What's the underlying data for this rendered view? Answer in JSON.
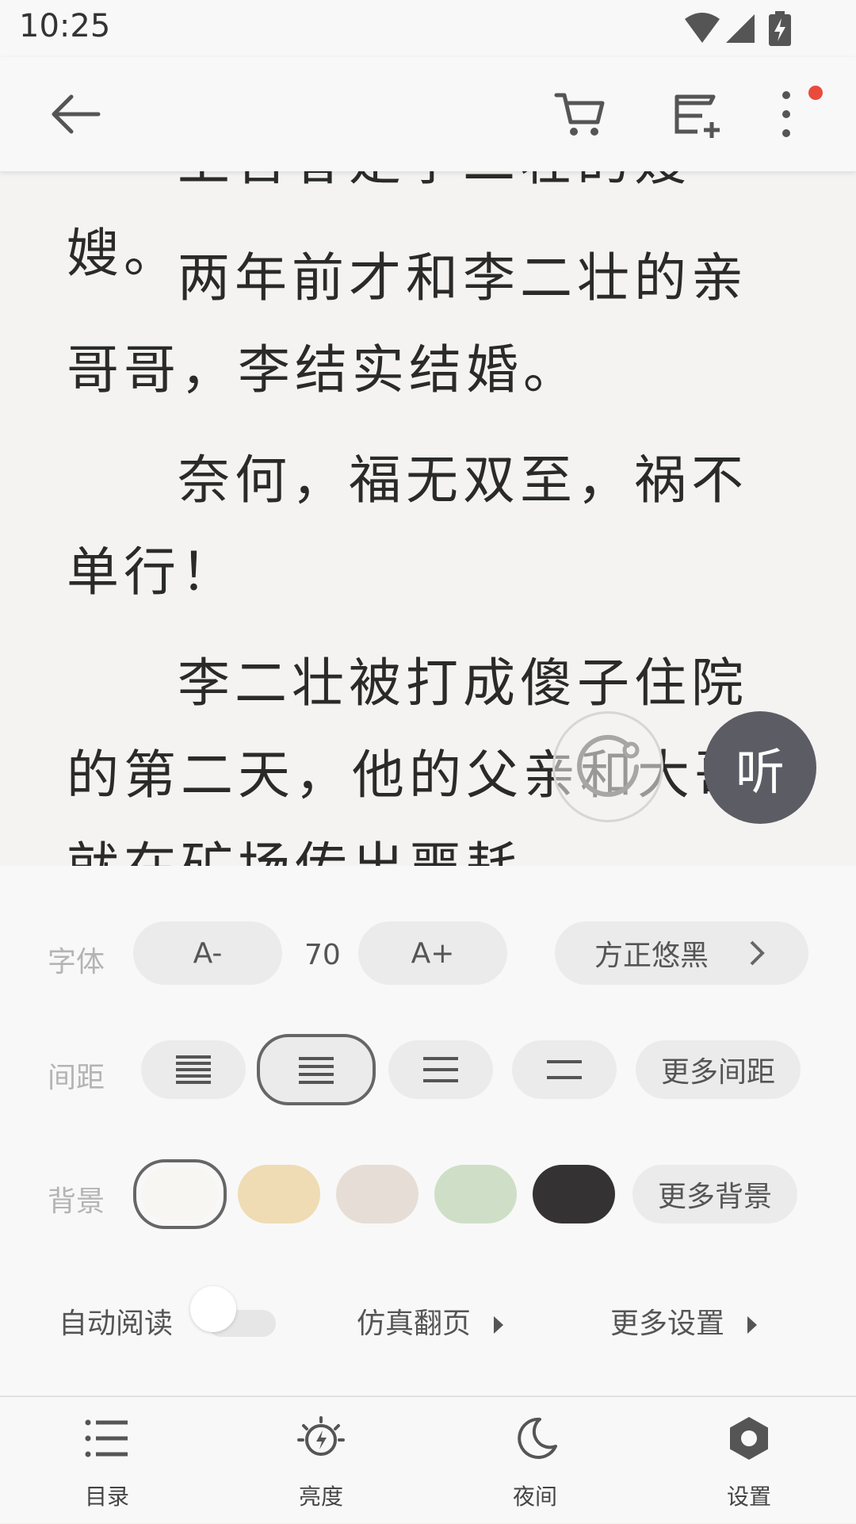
{
  "status_bar": {
    "time": "10:25",
    "icons": [
      "wifi-icon",
      "signal-icon",
      "battery-charging-icon"
    ]
  },
  "top_bar": {
    "icons": [
      "back-arrow-icon",
      "cart-icon",
      "add-to-shelf-icon",
      "more-vertical-icon"
    ],
    "notification_dot_color": "#e94b3c"
  },
  "reader": {
    "partial_top_line": "上官春是李二壮的嫂嫂。",
    "paragraphs": [
      "两年前才和李二壮的亲哥哥，李结实结婚。",
      "奈何，福无双至，祸不单行！",
      "李二壮被打成傻子住院的第二天，他的父亲和大哥就在矿场传出噩耗"
    ],
    "listen_label": "听"
  },
  "settings": {
    "font": {
      "label": "字体",
      "decrease_label": "A-",
      "size_value": "70",
      "increase_label": "A+",
      "font_name": "方正悠黑"
    },
    "spacing": {
      "label": "间距",
      "options": [
        "tight",
        "normal",
        "loose",
        "extra-loose"
      ],
      "selected_index": 1,
      "more_label": "更多间距"
    },
    "background": {
      "label": "背景",
      "swatches": [
        "#f7f6f3",
        "#efdcb4",
        "#e6ded6",
        "#cfdfc7",
        "#353233"
      ],
      "selected_index": 0,
      "more_label": "更多背景"
    },
    "misc": {
      "auto_read_label": "自动阅读",
      "auto_read_on": false,
      "page_turn_label": "仿真翻页",
      "more_settings_label": "更多设置"
    }
  },
  "tab_bar": {
    "items": [
      {
        "label": "目录",
        "icon": "list-icon"
      },
      {
        "label": "亮度",
        "icon": "brightness-icon"
      },
      {
        "label": "夜间",
        "icon": "moon-icon"
      },
      {
        "label": "设置",
        "icon": "settings-icon"
      }
    ]
  }
}
